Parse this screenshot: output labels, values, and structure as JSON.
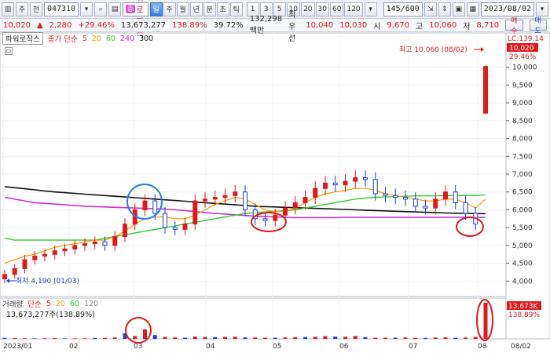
{
  "toolbar": {
    "period_label": "주",
    "toggle_label": "전",
    "code": "047310",
    "stock_tag": "증",
    "stock_name": "파워로직스",
    "periods": [
      {
        "label": "일",
        "active": true
      },
      {
        "label": "주",
        "active": false
      },
      {
        "label": "월",
        "active": false
      },
      {
        "label": "년",
        "active": false
      },
      {
        "label": "분",
        "active": false
      },
      {
        "label": "초",
        "active": false
      },
      {
        "label": "틱",
        "active": false
      }
    ],
    "intervals": [
      "1",
      "3",
      "5",
      "10",
      "20",
      "30",
      "60",
      "120"
    ],
    "count_value": "145",
    "count_total": "/600",
    "date_value": "2023/08/02"
  },
  "quote": {
    "price": "10,020",
    "arrow": "▲",
    "change": "2,280",
    "change_pct": "+29.46%",
    "volume": "13,673,277",
    "volume_ratio": "138.89%",
    "turnover": "39.72%",
    "amount": "132,298백만",
    "best_label": "최우선",
    "ask": "10,040",
    "bid": "10,030",
    "open_label": "시",
    "open": "9,670",
    "high_label": "고",
    "high": "10,060",
    "low_label": "저",
    "low": "8,710",
    "buy_label": "매수",
    "sell_label": "매도"
  },
  "legend_main": {
    "title": "파워로직스",
    "ma_label": "종가 단순",
    "ma_periods": [
      {
        "label": "5",
        "color": "#e0191c"
      },
      {
        "label": "20",
        "color": "#ff9900"
      },
      {
        "label": "60",
        "color": "#33cc33"
      },
      {
        "label": "240",
        "color": "#cc33cc"
      },
      {
        "label": "300",
        "color": "#111111"
      }
    ]
  },
  "legend_vol": {
    "title": "거래량",
    "ma_label": "단순",
    "ma_periods": [
      {
        "label": "5",
        "color": "#e0191c"
      },
      {
        "label": "20",
        "color": "#ff9900"
      },
      {
        "label": "60",
        "color": "#33cc33"
      },
      {
        "label": "120",
        "color": "#888888"
      }
    ],
    "volume_text": "13,673,277주(138.89%)"
  },
  "annotations": {
    "high_text": "최고 10,060 (08/02)",
    "low_text": "최저 4,190 (01/03)",
    "lc_text": "LC:139.14",
    "current_price_tag": "10,020",
    "current_pct_tag": "29.46%",
    "vol_tag": "13,673K",
    "vol_pct_tag": "138.89%"
  },
  "colors": {
    "up": "#e0191c",
    "down": "#1a3fd1",
    "ma5": "#e0191c",
    "ma20": "#ff9900",
    "ma60": "#33cc33",
    "ma240": "#cc33cc",
    "ma300": "#111111",
    "circle_blue": "#2b7de0",
    "circle_red": "#e0191c"
  },
  "chart_data": {
    "type": "candlestick",
    "y_ticks": [
      "10,000",
      "9,500",
      "9,000",
      "8,500",
      "8,000",
      "7,500",
      "7,000",
      "6,500",
      "6,000",
      "5,500",
      "5,000",
      "4,500",
      "4,000"
    ],
    "ylim": [
      3700,
      10300
    ],
    "x_labels": [
      "2023/01",
      "02",
      "03",
      "04",
      "05",
      "06",
      "07",
      "08",
      "08/02"
    ],
    "price_series": [
      4190,
      4350,
      4600,
      4700,
      4750,
      4850,
      4900,
      5000,
      5050,
      5100,
      5000,
      5250,
      5600,
      6000,
      6250,
      5900,
      5500,
      5450,
      5600,
      6250,
      6300,
      6350,
      6400,
      6500,
      6000,
      5750,
      5700,
      5850,
      6050,
      6200,
      6350,
      6600,
      6750,
      6700,
      6800,
      6900,
      6850,
      6450,
      6400,
      6350,
      6300,
      6100,
      6050,
      6300,
      6500,
      6200,
      5900,
      5600,
      10020
    ],
    "ma20_series": [
      4500,
      4600,
      4700,
      4750,
      4850,
      4950,
      5000,
      5050,
      5100,
      5150,
      5150,
      5250,
      5400,
      5600,
      5750,
      5800,
      5800,
      5750,
      5750,
      5850,
      6000,
      6150,
      6250,
      6350,
      6300,
      6150,
      6000,
      5950,
      5950,
      6050,
      6200,
      6350,
      6450,
      6500,
      6550,
      6600,
      6600,
      6550,
      6450,
      6400,
      6350,
      6300,
      6250,
      6250,
      6300,
      6300,
      6200,
      6050,
      6300
    ],
    "ma60_series": [
      5200,
      5150,
      5150,
      5150,
      5150,
      5150,
      5150,
      5150,
      5150,
      5150,
      5200,
      5250,
      5300,
      5350,
      5400,
      5450,
      5500,
      5550,
      5600,
      5650,
      5700,
      5750,
      5800,
      5850,
      5900,
      5920,
      5940,
      5960,
      5980,
      6000,
      6050,
      6100,
      6150,
      6200,
      6250,
      6300,
      6330,
      6350,
      6360,
      6370,
      6380,
      6390,
      6390,
      6390,
      6400,
      6400,
      6400,
      6400,
      6420
    ],
    "ma240_series": [
      6350,
      6300,
      6250,
      6200,
      6180,
      6160,
      6140,
      6120,
      6100,
      6090,
      6080,
      6070,
      6060,
      6050,
      6040,
      6030,
      6020,
      6000,
      5980,
      5950,
      5920,
      5900,
      5880,
      5860,
      5840,
      5820,
      5810,
      5800,
      5790,
      5780,
      5780,
      5780,
      5780,
      5780,
      5790,
      5790,
      5790,
      5790,
      5790,
      5790,
      5790,
      5790,
      5790,
      5790,
      5790,
      5790,
      5790,
      5790,
      5790
    ],
    "ma300_series": [
      6650,
      6620,
      6590,
      6560,
      6530,
      6500,
      6480,
      6460,
      6440,
      6420,
      6400,
      6380,
      6360,
      6340,
      6320,
      6300,
      6280,
      6260,
      6240,
      6220,
      6200,
      6180,
      6160,
      6140,
      6120,
      6100,
      6090,
      6080,
      6070,
      6060,
      6050,
      6040,
      6030,
      6020,
      6010,
      6000,
      5990,
      5980,
      5970,
      5960,
      5950,
      5940,
      5930,
      5920,
      5910,
      5905,
      5900,
      5895,
      5890
    ],
    "volume_series": [
      10,
      8,
      6,
      5,
      6,
      8,
      5,
      5,
      6,
      8,
      10,
      14,
      60,
      30,
      100,
      40,
      20,
      15,
      12,
      25,
      20,
      18,
      20,
      22,
      15,
      15,
      12,
      12,
      14,
      18,
      20,
      22,
      28,
      24,
      22,
      30,
      18,
      12,
      12,
      12,
      14,
      10,
      10,
      14,
      16,
      12,
      14,
      20,
      380
    ]
  }
}
